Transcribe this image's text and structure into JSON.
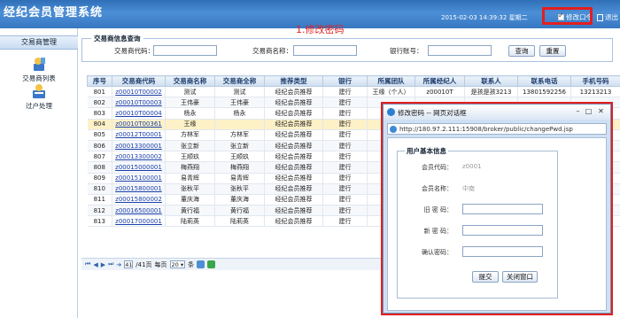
{
  "header": {
    "app_title": "经纪会员管理系统",
    "datetime": "2015-02-03 14:39:32",
    "weekday": "星期二",
    "change_password_label": "修改口令",
    "logout_label": "退出"
  },
  "annotation": "1.修改密码",
  "sidebar": {
    "section_title": "交易商管理",
    "items": [
      {
        "label": "交易商列表",
        "icon": "user-list-icon"
      },
      {
        "label": "过户处理",
        "icon": "transfer-icon"
      }
    ]
  },
  "query": {
    "legend": "交易商信息查询",
    "fields": [
      {
        "label": "交易商代码：",
        "value": ""
      },
      {
        "label": "交易商名称：",
        "value": ""
      },
      {
        "label": "银行账号：",
        "value": ""
      }
    ],
    "query_button": "查询",
    "reset_button": "重置"
  },
  "table": {
    "columns": [
      "序号",
      "交易商代码",
      "交易商名称",
      "交易商全称",
      "推荐类型",
      "银行",
      "所属团队",
      "所属经纪人",
      "联系人",
      "联系电话",
      "手机号码"
    ],
    "rows": [
      [
        "801",
        "z00010T00002",
        "测试",
        "测试",
        "经纪会员推荐",
        "建行",
        "王缘（个人）",
        "z00010T",
        "是孩是孩3213",
        "13801592256",
        "13213213"
      ],
      [
        "802",
        "z00010T00003",
        "王伟豪",
        "王伟豪",
        "经纪会员推荐",
        "建行",
        "",
        "",
        "",
        "",
        ""
      ],
      [
        "803",
        "z00010T00004",
        "杨永",
        "杨永",
        "经纪会员推荐",
        "建行",
        "",
        "",
        "",
        "",
        ""
      ],
      [
        "804",
        "z00010T00361",
        "王缘",
        "",
        "经纪会员推荐",
        "建行",
        "",
        "",
        "",
        "",
        ""
      ],
      [
        "805",
        "z00012T00001",
        "方林军",
        "方林军",
        "经纪会员推荐",
        "建行",
        "",
        "",
        "",
        "",
        ""
      ],
      [
        "806",
        "z00013300001",
        "张立新",
        "张立新",
        "经纪会员推荐",
        "建行",
        "",
        "",
        "",
        "",
        ""
      ],
      [
        "807",
        "z00013300002",
        "王顺玖",
        "王顺玖",
        "经纪会员推荐",
        "建行",
        "",
        "",
        "",
        "",
        ""
      ],
      [
        "808",
        "z00015000001",
        "梅燕翔",
        "梅燕翔",
        "经纪会员推荐",
        "建行",
        "",
        "",
        "",
        "",
        ""
      ],
      [
        "809",
        "z00015100001",
        "易青辉",
        "易青辉",
        "经纪会员推荐",
        "建行",
        "",
        "",
        "",
        "",
        ""
      ],
      [
        "810",
        "z00015800001",
        "张秋平",
        "张秋平",
        "经纪会员推荐",
        "建行",
        "",
        "",
        "",
        "",
        ""
      ],
      [
        "811",
        "z00015800002",
        "董庆海",
        "董庆海",
        "经纪会员推荐",
        "建行",
        "",
        "",
        "",
        "",
        ""
      ],
      [
        "812",
        "z00016500001",
        "黄行福",
        "黄行福",
        "经纪会员推荐",
        "建行",
        "",
        "",
        "",
        "",
        ""
      ],
      [
        "813",
        "z00017000001",
        "陆莉英",
        "陆莉英",
        "经纪会员推荐",
        "建行",
        "",
        "",
        "",
        "",
        ""
      ]
    ],
    "selected_row": 3
  },
  "pager": {
    "current_page": "41",
    "total_pages_text": "/41页",
    "per_page_label": "每页",
    "per_page_value": "20",
    "per_page_unit": "条"
  },
  "dialog": {
    "title": "修改密码 -- 网页对话框",
    "url": "http://180.97.2.111:15908/broker/public/changePwd.jsp",
    "legend": "用户基本信息",
    "fields": [
      {
        "label": "会员代码：",
        "value": "z0001"
      },
      {
        "label": "会员名称：",
        "value": "中南"
      },
      {
        "label": "旧 密 码：",
        "value": ""
      },
      {
        "label": "新 密 码：",
        "value": ""
      },
      {
        "label": "确认密码：",
        "value": ""
      }
    ],
    "submit_button": "提交",
    "close_button": "关闭窗口"
  },
  "colors": {
    "header_blue": "#3a7bc8",
    "highlight_red": "#e41e1e",
    "link_blue": "#1a3fa8",
    "selected_row": "#fdf1c8"
  }
}
